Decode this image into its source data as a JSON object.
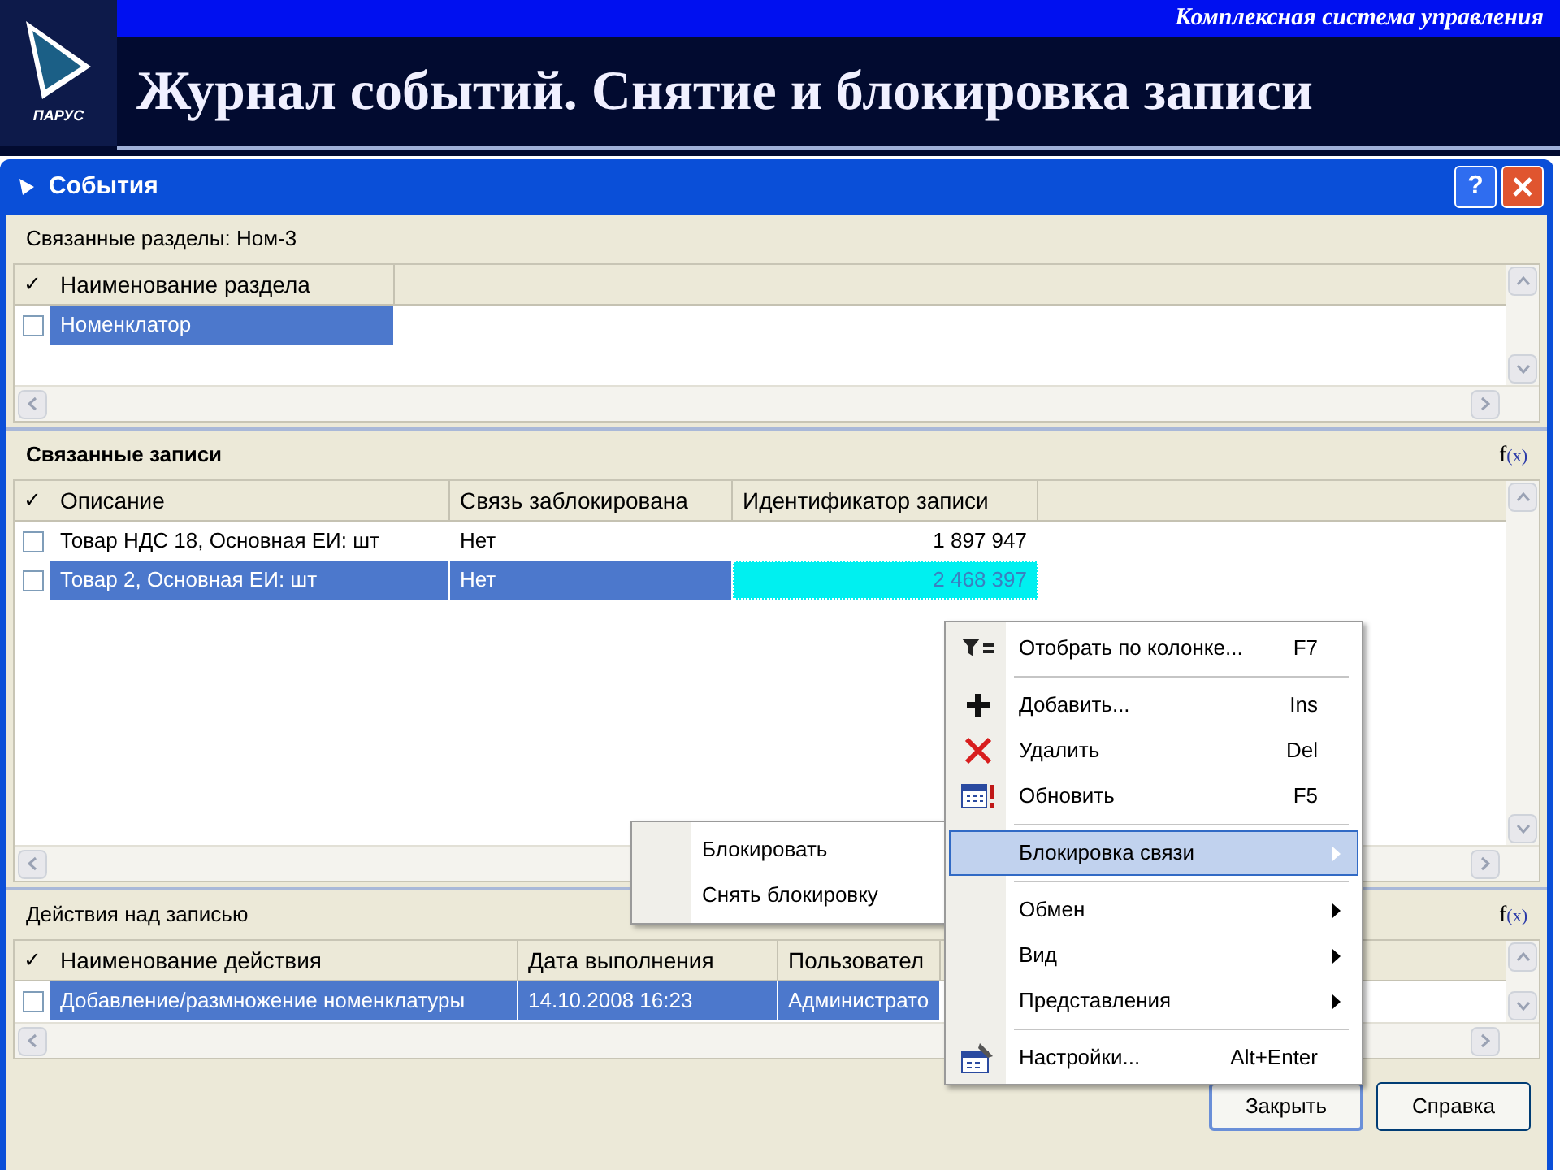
{
  "slide": {
    "logo_text": "ПАРУС",
    "subtitle": "Комплексная система управления",
    "title": "Журнал событий. Снятие и блокировка записи"
  },
  "window": {
    "title": "События",
    "help_label": "?"
  },
  "sections": [
    {
      "heading": "Связанные разделы: Ном-3",
      "heading_bold": false,
      "check_header": "✓",
      "columns": [
        {
          "label": "Наименование раздела",
          "kind": "text"
        }
      ],
      "rows": [
        {
          "checked": false,
          "selected": true,
          "cells": [
            {
              "text": "Номенклатор",
              "focused": false
            }
          ]
        }
      ]
    },
    {
      "heading": "Связанные записи",
      "heading_bold": true,
      "formula": {
        "f": "f",
        "arg": "(x)"
      },
      "check_header": "✓",
      "columns": [
        {
          "label": "Описание",
          "kind": "text"
        },
        {
          "label": "Связь заблокирована",
          "kind": "text"
        },
        {
          "label": "Идентификатор записи",
          "kind": "number"
        }
      ],
      "rows": [
        {
          "checked": false,
          "selected": false,
          "cells": [
            {
              "text": "Товар НДС 18, Основная ЕИ: шт",
              "focused": false
            },
            {
              "text": "Нет",
              "focused": false
            },
            {
              "text": "1 897 947",
              "focused": false
            }
          ]
        },
        {
          "checked": false,
          "selected": true,
          "cells": [
            {
              "text": "Товар 2, Основная ЕИ: шт",
              "focused": false
            },
            {
              "text": "Нет",
              "focused": false
            },
            {
              "text": "2 468 397",
              "focused": true
            }
          ]
        }
      ]
    },
    {
      "heading": "Действия над записью",
      "heading_bold": false,
      "formula": {
        "f": "f",
        "arg": "(x)"
      },
      "check_header": "✓",
      "columns": [
        {
          "label": "Наименование действия",
          "kind": "text"
        },
        {
          "label": "Дата выполнения",
          "kind": "text"
        },
        {
          "label": "Пользовател",
          "kind": "text"
        }
      ],
      "rows": [
        {
          "checked": false,
          "selected": true,
          "cells": [
            {
              "text": "Добавление/размножение номенклатуры",
              "focused": false
            },
            {
              "text": "14.10.2008 16:23",
              "focused": false
            },
            {
              "text": "Администрато",
              "focused": false
            }
          ]
        }
      ]
    }
  ],
  "context_menu": [
    {
      "kind": "item",
      "label": "Отобрать по колонке...",
      "shortcut": "F7",
      "selected": false
    },
    {
      "kind": "separator"
    },
    {
      "kind": "item",
      "label": "Добавить...",
      "shortcut": "Ins",
      "selected": false
    },
    {
      "kind": "item",
      "label": "Удалить",
      "shortcut": "Del",
      "selected": false
    },
    {
      "kind": "item",
      "label": "Обновить",
      "shortcut": "F5",
      "selected": false
    },
    {
      "kind": "separator"
    },
    {
      "kind": "submenu",
      "label": "Блокировка связи",
      "selected": true,
      "children": [
        {
          "label": "Блокировать"
        },
        {
          "label": "Снять блокировку"
        }
      ]
    },
    {
      "kind": "separator"
    },
    {
      "kind": "submenu",
      "label": "Обмен",
      "selected": false
    },
    {
      "kind": "submenu",
      "label": "Вид",
      "selected": false
    },
    {
      "kind": "submenu",
      "label": "Представления",
      "selected": false
    },
    {
      "kind": "separator"
    },
    {
      "kind": "item",
      "label": "Настройки...",
      "shortcut": "Alt+Enter",
      "selected": false
    }
  ],
  "buttons": [
    {
      "label": "Закрыть",
      "default": true
    },
    {
      "label": "Справка",
      "default": false
    }
  ]
}
